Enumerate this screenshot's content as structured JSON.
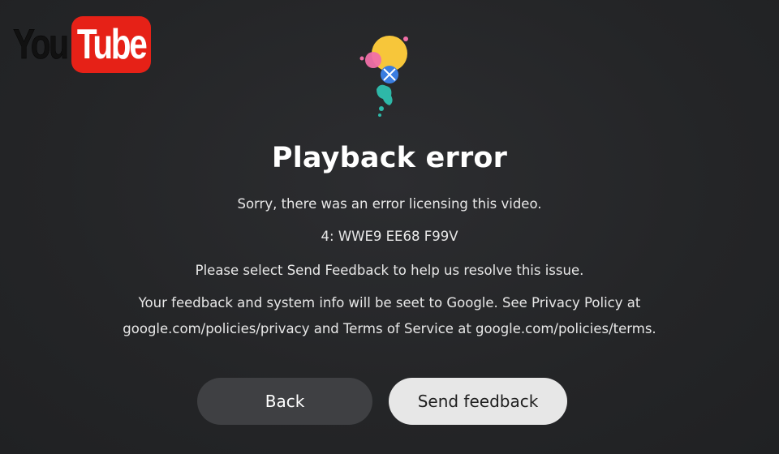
{
  "logo": {
    "you": "You",
    "tube": "Tube",
    "brand_red": "#e62117"
  },
  "illustration": {
    "icon": "error-confetti-illustration",
    "colors": [
      "#f6c637",
      "#f06fa8",
      "#3a7de0",
      "#2eb8a8"
    ]
  },
  "dialog": {
    "title": "Playback error",
    "message": "Sorry, there was an error licensing this video.",
    "error_code": "4: WWE9 EE68 F99V",
    "instruction": "Please select Send Feedback to help us resolve this issue.",
    "info_line1": "Your feedback and system info will be seet to Google. See Privacy Policy at",
    "info_line2": "google.com/policies/privacy and Terms of Service at google.com/policies/terms."
  },
  "buttons": {
    "back_label": "Back",
    "send_label": "Send feedback"
  },
  "colors": {
    "background": "#252628",
    "back_button": "#3f4043",
    "send_button": "#e7e7e7"
  }
}
